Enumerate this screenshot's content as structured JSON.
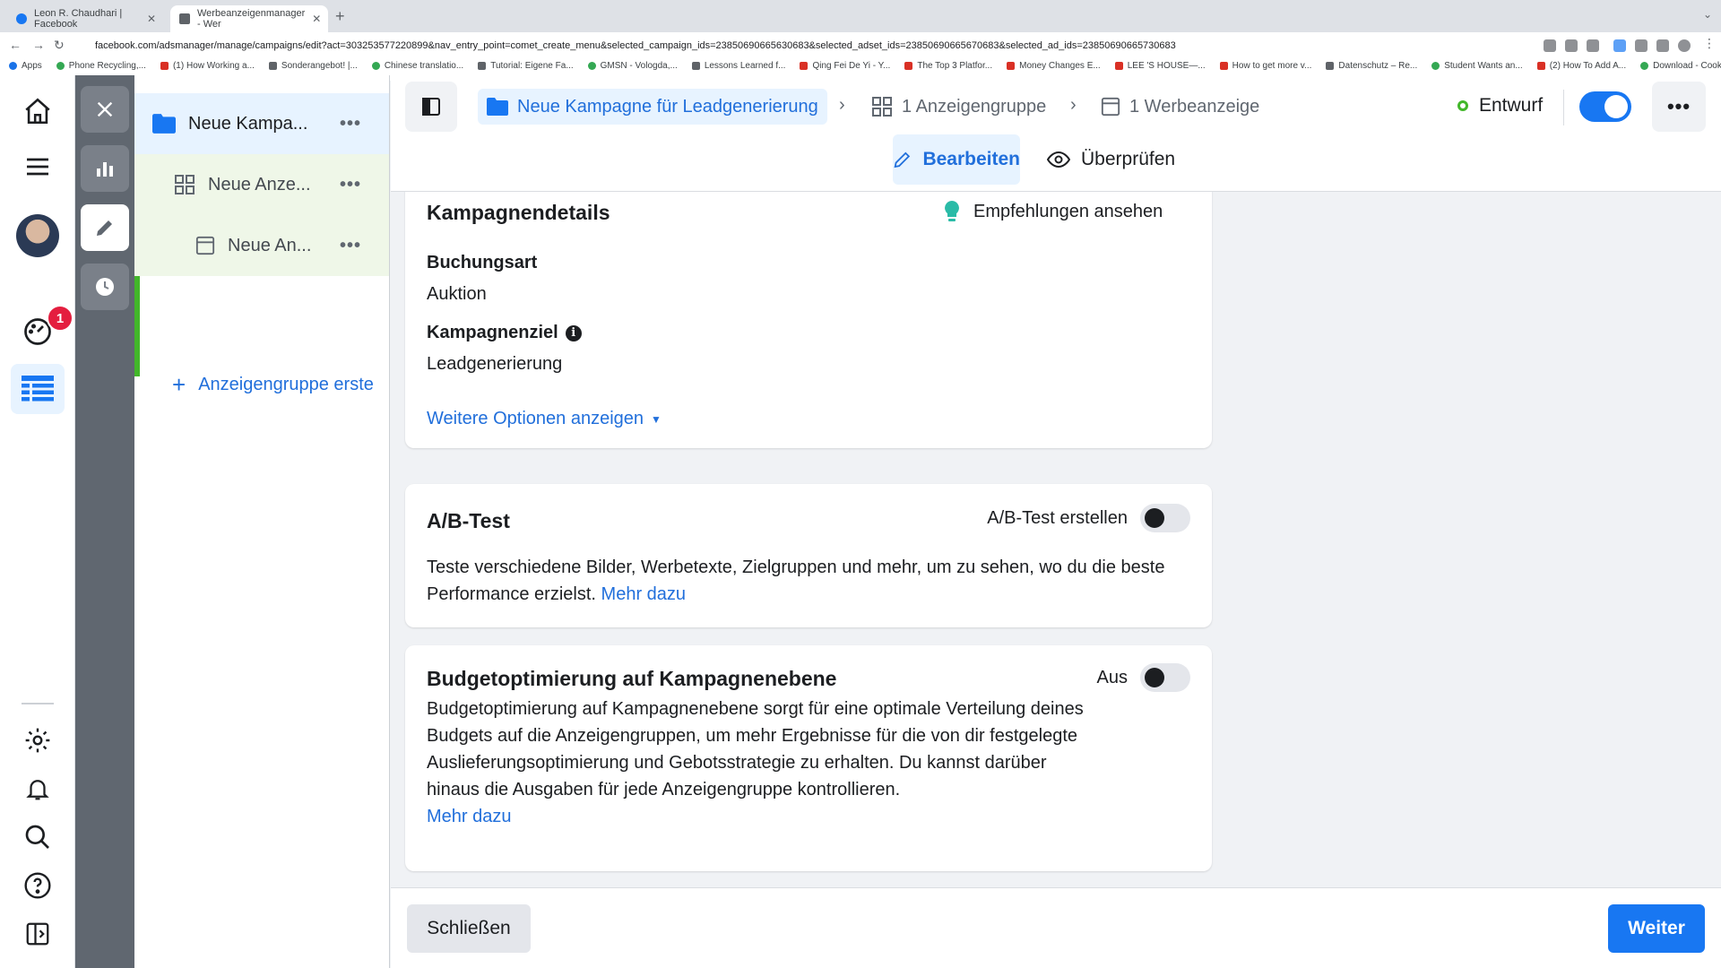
{
  "browser": {
    "tabs": [
      {
        "title": "Leon R. Chaudhari | Facebook"
      },
      {
        "title": "Werbeanzeigenmanager - Wer"
      }
    ],
    "url": "facebook.com/adsmanager/manage/campaigns/edit?act=303253577220899&nav_entry_point=comet_create_menu&selected_campaign_ids=23850690665630683&selected_adset_ids=23850690665670683&selected_ad_ids=23850690665730683",
    "bookmarks": [
      "Apps",
      "Phone Recycling,...",
      "(1) How Working a...",
      "Sonderangebot! |...",
      "Chinese translatio...",
      "Tutorial: Eigene Fa...",
      "GMSN - Vologda,...",
      "Lessons Learned f...",
      "Qing Fei De Yi - Y...",
      "The Top 3 Platfor...",
      "Money Changes E...",
      "LEE 'S HOUSE—...",
      "How to get more v...",
      "Datenschutz – Re...",
      "Student Wants an...",
      "(2) How To Add A...",
      "Download - Cooki..."
    ]
  },
  "rail": {
    "notification_count": "1"
  },
  "tree": {
    "campaign": "Neue Kampa...",
    "adset": "Neue Anze...",
    "ad": "Neue An...",
    "add_adset": "Anzeigengruppe erste"
  },
  "header": {
    "campaign_crumb": "Neue Kampagne für Leadgenerierung",
    "adset_crumb": "1 Anzeigengruppe",
    "ad_crumb": "1 Werbeanzeige",
    "status": "Entwurf",
    "tab_edit": "Bearbeiten",
    "tab_review": "Überprüfen"
  },
  "details": {
    "title": "Kampagnendetails",
    "recommendations": "Empfehlungen ansehen",
    "buying_type_label": "Buchungsart",
    "buying_type_value": "Auktion",
    "objective_label": "Kampagnenziel",
    "objective_value": "Leadgenerierung",
    "more_options": "Weitere Optionen anzeigen"
  },
  "abtest": {
    "title": "A/B-Test",
    "toggle_label": "A/B-Test erstellen",
    "description": "Teste verschiedene Bilder, Werbetexte, Zielgruppen und mehr, um zu sehen, wo du die beste Performance erzielst.",
    "learn_more": "Mehr dazu"
  },
  "budget": {
    "title": "Budgetoptimierung auf Kampagnenebene",
    "toggle_label": "Aus",
    "description": "Budgetoptimierung auf Kampagnenebene sorgt für eine optimale Verteilung deines Budgets auf die Anzeigengruppen, um mehr Ergebnisse für die von dir festgelegte Auslieferungsoptimierung und Gebotsstrategie zu erhalten. Du kannst darüber hinaus die Ausgaben für jede Anzeigengruppe kontrollieren.",
    "learn_more": "Mehr dazu"
  },
  "footer": {
    "close": "Schließen",
    "next": "Weiter"
  },
  "colors": {
    "accent": "#1877f2",
    "link": "#216fdb",
    "draft_green": "#42b72a",
    "badge_red": "#e41e3f"
  }
}
